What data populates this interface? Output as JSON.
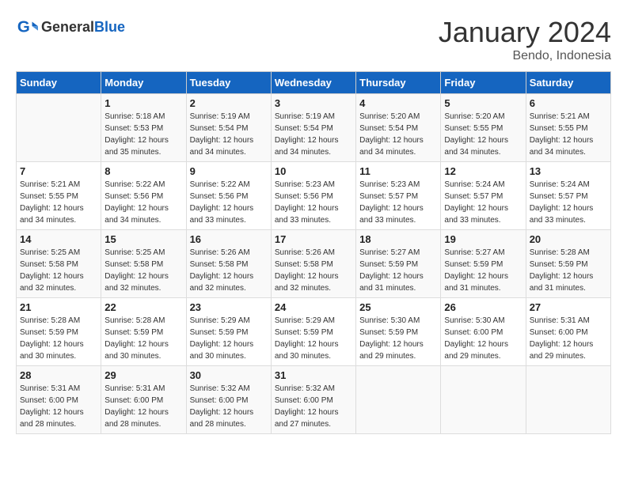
{
  "header": {
    "logo_general": "General",
    "logo_blue": "Blue",
    "month_title": "January 2024",
    "location": "Bendo, Indonesia"
  },
  "days_of_week": [
    "Sunday",
    "Monday",
    "Tuesday",
    "Wednesday",
    "Thursday",
    "Friday",
    "Saturday"
  ],
  "weeks": [
    [
      {
        "day": "",
        "info": ""
      },
      {
        "day": "1",
        "info": "Sunrise: 5:18 AM\nSunset: 5:53 PM\nDaylight: 12 hours\nand 35 minutes."
      },
      {
        "day": "2",
        "info": "Sunrise: 5:19 AM\nSunset: 5:54 PM\nDaylight: 12 hours\nand 34 minutes."
      },
      {
        "day": "3",
        "info": "Sunrise: 5:19 AM\nSunset: 5:54 PM\nDaylight: 12 hours\nand 34 minutes."
      },
      {
        "day": "4",
        "info": "Sunrise: 5:20 AM\nSunset: 5:54 PM\nDaylight: 12 hours\nand 34 minutes."
      },
      {
        "day": "5",
        "info": "Sunrise: 5:20 AM\nSunset: 5:55 PM\nDaylight: 12 hours\nand 34 minutes."
      },
      {
        "day": "6",
        "info": "Sunrise: 5:21 AM\nSunset: 5:55 PM\nDaylight: 12 hours\nand 34 minutes."
      }
    ],
    [
      {
        "day": "7",
        "info": "Sunrise: 5:21 AM\nSunset: 5:55 PM\nDaylight: 12 hours\nand 34 minutes."
      },
      {
        "day": "8",
        "info": "Sunrise: 5:22 AM\nSunset: 5:56 PM\nDaylight: 12 hours\nand 34 minutes."
      },
      {
        "day": "9",
        "info": "Sunrise: 5:22 AM\nSunset: 5:56 PM\nDaylight: 12 hours\nand 33 minutes."
      },
      {
        "day": "10",
        "info": "Sunrise: 5:23 AM\nSunset: 5:56 PM\nDaylight: 12 hours\nand 33 minutes."
      },
      {
        "day": "11",
        "info": "Sunrise: 5:23 AM\nSunset: 5:57 PM\nDaylight: 12 hours\nand 33 minutes."
      },
      {
        "day": "12",
        "info": "Sunrise: 5:24 AM\nSunset: 5:57 PM\nDaylight: 12 hours\nand 33 minutes."
      },
      {
        "day": "13",
        "info": "Sunrise: 5:24 AM\nSunset: 5:57 PM\nDaylight: 12 hours\nand 33 minutes."
      }
    ],
    [
      {
        "day": "14",
        "info": "Sunrise: 5:25 AM\nSunset: 5:58 PM\nDaylight: 12 hours\nand 32 minutes."
      },
      {
        "day": "15",
        "info": "Sunrise: 5:25 AM\nSunset: 5:58 PM\nDaylight: 12 hours\nand 32 minutes."
      },
      {
        "day": "16",
        "info": "Sunrise: 5:26 AM\nSunset: 5:58 PM\nDaylight: 12 hours\nand 32 minutes."
      },
      {
        "day": "17",
        "info": "Sunrise: 5:26 AM\nSunset: 5:58 PM\nDaylight: 12 hours\nand 32 minutes."
      },
      {
        "day": "18",
        "info": "Sunrise: 5:27 AM\nSunset: 5:59 PM\nDaylight: 12 hours\nand 31 minutes."
      },
      {
        "day": "19",
        "info": "Sunrise: 5:27 AM\nSunset: 5:59 PM\nDaylight: 12 hours\nand 31 minutes."
      },
      {
        "day": "20",
        "info": "Sunrise: 5:28 AM\nSunset: 5:59 PM\nDaylight: 12 hours\nand 31 minutes."
      }
    ],
    [
      {
        "day": "21",
        "info": "Sunrise: 5:28 AM\nSunset: 5:59 PM\nDaylight: 12 hours\nand 30 minutes."
      },
      {
        "day": "22",
        "info": "Sunrise: 5:28 AM\nSunset: 5:59 PM\nDaylight: 12 hours\nand 30 minutes."
      },
      {
        "day": "23",
        "info": "Sunrise: 5:29 AM\nSunset: 5:59 PM\nDaylight: 12 hours\nand 30 minutes."
      },
      {
        "day": "24",
        "info": "Sunrise: 5:29 AM\nSunset: 5:59 PM\nDaylight: 12 hours\nand 30 minutes."
      },
      {
        "day": "25",
        "info": "Sunrise: 5:30 AM\nSunset: 5:59 PM\nDaylight: 12 hours\nand 29 minutes."
      },
      {
        "day": "26",
        "info": "Sunrise: 5:30 AM\nSunset: 6:00 PM\nDaylight: 12 hours\nand 29 minutes."
      },
      {
        "day": "27",
        "info": "Sunrise: 5:31 AM\nSunset: 6:00 PM\nDaylight: 12 hours\nand 29 minutes."
      }
    ],
    [
      {
        "day": "28",
        "info": "Sunrise: 5:31 AM\nSunset: 6:00 PM\nDaylight: 12 hours\nand 28 minutes."
      },
      {
        "day": "29",
        "info": "Sunrise: 5:31 AM\nSunset: 6:00 PM\nDaylight: 12 hours\nand 28 minutes."
      },
      {
        "day": "30",
        "info": "Sunrise: 5:32 AM\nSunset: 6:00 PM\nDaylight: 12 hours\nand 28 minutes."
      },
      {
        "day": "31",
        "info": "Sunrise: 5:32 AM\nSunset: 6:00 PM\nDaylight: 12 hours\nand 27 minutes."
      },
      {
        "day": "",
        "info": ""
      },
      {
        "day": "",
        "info": ""
      },
      {
        "day": "",
        "info": ""
      }
    ]
  ]
}
